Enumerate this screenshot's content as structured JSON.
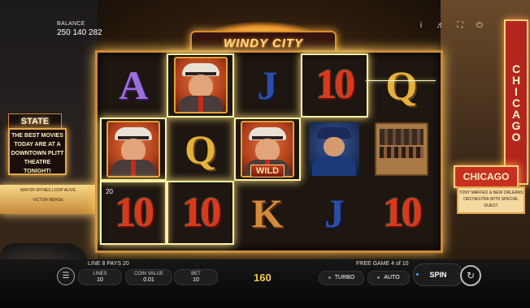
{
  "balance": {
    "label": "BALANCE",
    "value": "250 140 282"
  },
  "top_icons": [
    "info-icon",
    "sound-icon",
    "fullscreen-icon",
    "power-icon"
  ],
  "game_title": "WINDY CITY",
  "scenery": {
    "state_lake_sign": "STATE LAKE",
    "left_board": "THE BEST MOVIES TODAY ARE AT A DOWNTOWN PLITT THEATRE TONIGHT!",
    "left_marquee": [
      "MAYOR WYNES LOOP ALIVE",
      "VICTOR BERGE"
    ],
    "chicago_vertical": "CHICAGO",
    "chicago_banner": "CHICAGO",
    "chicago_board": [
      "TONY MAFFEO & NEW ORLEANS",
      "ORCHESTRA WITH SPECIAL GUEST"
    ]
  },
  "reels": [
    [
      {
        "symbol": "A",
        "type": "letter"
      },
      {
        "symbol": "gangster",
        "type": "portrait",
        "win": true
      },
      {
        "symbol": "J",
        "type": "letter"
      },
      {
        "symbol": "10",
        "type": "letter",
        "win": true
      },
      {
        "symbol": "Q",
        "type": "letter"
      }
    ],
    [
      {
        "symbol": "gangster",
        "type": "portrait",
        "win": true
      },
      {
        "symbol": "Q",
        "type": "letter"
      },
      {
        "symbol": "gangster",
        "type": "portrait",
        "win": true,
        "wild_label": "WILD"
      },
      {
        "symbol": "detective",
        "type": "detective"
      },
      {
        "symbol": "crate",
        "type": "crate"
      }
    ],
    [
      {
        "symbol": "10",
        "type": "letter",
        "win": true
      },
      {
        "symbol": "10",
        "type": "letter",
        "win": true
      },
      {
        "symbol": "K",
        "type": "letter"
      },
      {
        "symbol": "J",
        "type": "letter"
      },
      {
        "symbol": "10",
        "type": "letter"
      }
    ]
  ],
  "payline_indicator": "20",
  "bottom": {
    "line_pays": "LINE 8 PAYS 20",
    "free_game": "FREE GAME 4 of 10",
    "lines": {
      "label": "LINES",
      "value": "10"
    },
    "coin_value": {
      "label": "COIN VALUE",
      "value": "0.01"
    },
    "bet": {
      "label": "BET",
      "value": "10"
    },
    "total_win": "160",
    "turbo": "TURBO",
    "auto": "AUTO",
    "spin": "SPIN"
  }
}
